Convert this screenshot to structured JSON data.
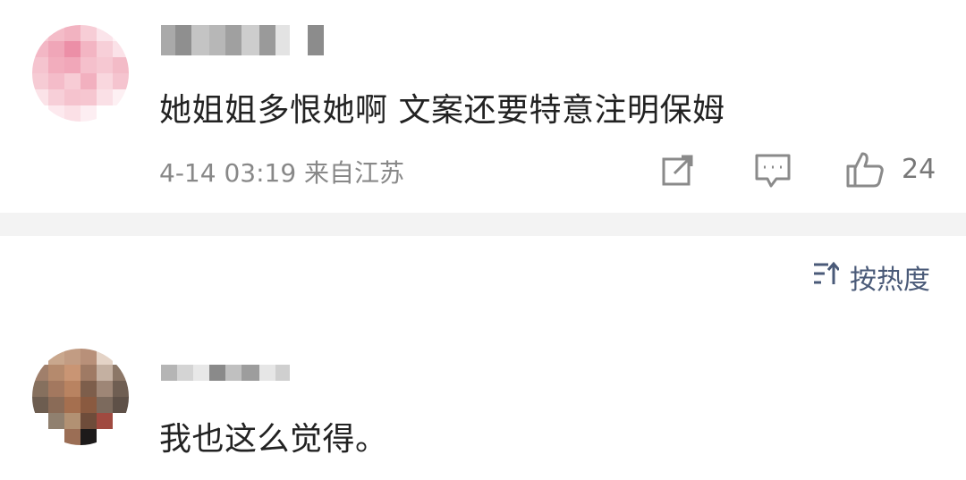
{
  "comments": [
    {
      "text": "她姐姐多恨她啊 文案还要特意注明保姆",
      "date": "4-14 03:19",
      "location": "来自江苏",
      "likes": "24",
      "icons": [
        "share-icon",
        "comment-icon",
        "like-icon"
      ],
      "avatar_colors": [
        "#f6c9d3",
        "#f4bcc8",
        "#f2b3c1",
        "#f7cdd6",
        "#fbe4ea",
        "#fff3f6",
        "#f3b7c5",
        "#f0a6b8",
        "#ec8fa7",
        "#f3b5c3",
        "#f7cfd8",
        "#fbe2e8",
        "#f5c4cf",
        "#f2adbd",
        "#f1a7b9",
        "#f5c0cc",
        "#f6c8d2",
        "#f3bbc7",
        "#f6cbd4",
        "#f4bcc9",
        "#f7ccd5",
        "#f2b0bf",
        "#f9d7de",
        "#f5c4cf",
        "#fbe3e8",
        "#f7cfd8",
        "#f5c3ce",
        "#f6c6d0",
        "#fae0e6",
        "#fdf0f3",
        "#ffffff",
        "#fde9ee",
        "#fbe0e6",
        "#fdeef2",
        "#ffffff",
        "#ffffff"
      ]
    },
    {
      "text": "我也这么觉得。",
      "avatar_colors": [
        "#ffffff",
        "#c9a78d",
        "#c29c83",
        "#b89079",
        "#e4d3c6",
        "#ffffff",
        "#a07f6b",
        "#b58a6d",
        "#c99574",
        "#9f7a64",
        "#c4b0a1",
        "#8c7767",
        "#86705e",
        "#a3785f",
        "#b98361",
        "#7d5e4b",
        "#9e8676",
        "#6f5e52",
        "#6d5d50",
        "#8a6b57",
        "#a56f4f",
        "#8a5a40",
        "#7c6a5d",
        "#5e5047",
        "#ffffff",
        "#90806f",
        "#b29173",
        "#6e4c3a",
        "#a04a40",
        "#ffffff",
        "#ffffff",
        "#ffffff",
        "#9b6e55",
        "#1d1a1a",
        "#ffffff",
        "#ffffff"
      ]
    }
  ],
  "sort": {
    "label": "按热度"
  }
}
